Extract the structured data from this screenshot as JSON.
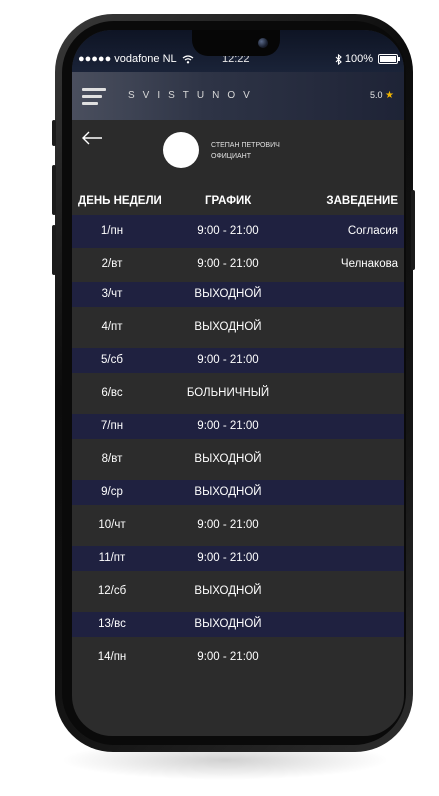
{
  "status_bar": {
    "carrier": "●●●●● vodafone NL",
    "time": "12:22",
    "battery_percent": "100%"
  },
  "header": {
    "brand": "SVISTUNOV",
    "rating_value": "5.0",
    "rating_star": "★"
  },
  "profile": {
    "name": "СТЕПАН ПЕТРОВИЧ",
    "role": "ОФИЦИАНТ",
    "back_arrow": "←"
  },
  "table": {
    "headers": [
      "ДЕНЬ НЕДЕЛИ",
      "ГРАФИК",
      "ЗАВЕДЕНИЕ"
    ],
    "rows": [
      {
        "day": "1/пн",
        "schedule": "9:00 - 21:00",
        "place": "Согласия"
      },
      {
        "day": "2/вт",
        "schedule": "9:00 - 21:00",
        "place": "Челнакова"
      },
      {
        "day": "3/чт",
        "schedule": "ВЫХОДНОЙ",
        "place": ""
      },
      {
        "day": "4/пт",
        "schedule": "ВЫХОДНОЙ",
        "place": ""
      },
      {
        "day": "5/сб",
        "schedule": "9:00 - 21:00",
        "place": ""
      },
      {
        "day": "6/вс",
        "schedule": "БОЛЬНИЧНЫЙ",
        "place": ""
      },
      {
        "day": "7/пн",
        "schedule": "9:00 - 21:00",
        "place": ""
      },
      {
        "day": "8/вт",
        "schedule": "ВЫХОДНОЙ",
        "place": ""
      },
      {
        "day": "9/ср",
        "schedule": "ВЫХОДНОЙ",
        "place": ""
      },
      {
        "day": "10/чт",
        "schedule": "9:00 - 21:00",
        "place": ""
      },
      {
        "day": "11/пт",
        "schedule": "9:00 - 21:00",
        "place": ""
      },
      {
        "day": "12/сб",
        "schedule": "ВЫХОДНОЙ",
        "place": ""
      },
      {
        "day": "13/вс",
        "schedule": "ВЫХОДНОЙ",
        "place": ""
      },
      {
        "day": "14/пн",
        "schedule": "9:00 - 21:00",
        "place": ""
      }
    ]
  },
  "icons": {
    "menu": "menu-icon",
    "back": "back-arrow-icon",
    "wifi": "wifi-icon",
    "bluetooth": "bluetooth-icon",
    "battery": "battery-icon",
    "star": "star-icon"
  },
  "colors": {
    "row_alt": "#1f2140",
    "row_plain": "#2c2c2c",
    "accent_star": "#f0b400"
  }
}
